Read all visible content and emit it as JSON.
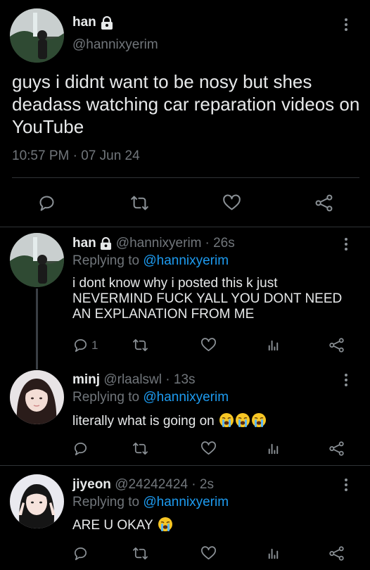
{
  "main_tweet": {
    "name": "han",
    "handle": "@hannixyerim",
    "text": "guys i didnt want to be nosy but shes deadass watching car reparation videos on YouTube",
    "timestamp": "10:57 PM · 07 Jun 24"
  },
  "replies": [
    {
      "name": "han",
      "handle": "@hannixyerim",
      "time": "· 26s",
      "replying_prefix": "Replying to",
      "replying_to": "@hannixyerim",
      "text": "i dont know why i posted this k just NEVERMIND FUCK YALL YOU DONT NEED AN EXPLANATION FROM ME",
      "reply_count": "1"
    },
    {
      "name": "minj",
      "handle": "@rlaalswl",
      "time": "· 13s",
      "replying_prefix": "Replying to",
      "replying_to": "@hannixyerim",
      "text": "literally what is going on",
      "reply_count": ""
    },
    {
      "name": "jiyeon",
      "handle": "@24242424",
      "time": "· 2s",
      "replying_prefix": "Replying to",
      "replying_to": "@hannixyerim",
      "text": "ARE U OKAY",
      "reply_count": ""
    }
  ],
  "icons": [
    "lock-icon",
    "more-icon",
    "reply-icon",
    "retweet-icon",
    "like-icon",
    "share-icon",
    "analytics-icon",
    "crying-emoji"
  ],
  "colors": {
    "background": "#000000",
    "text": "#e7e9ea",
    "muted": "#71767b",
    "link": "#1d9bf0",
    "divider": "#2f3336"
  }
}
